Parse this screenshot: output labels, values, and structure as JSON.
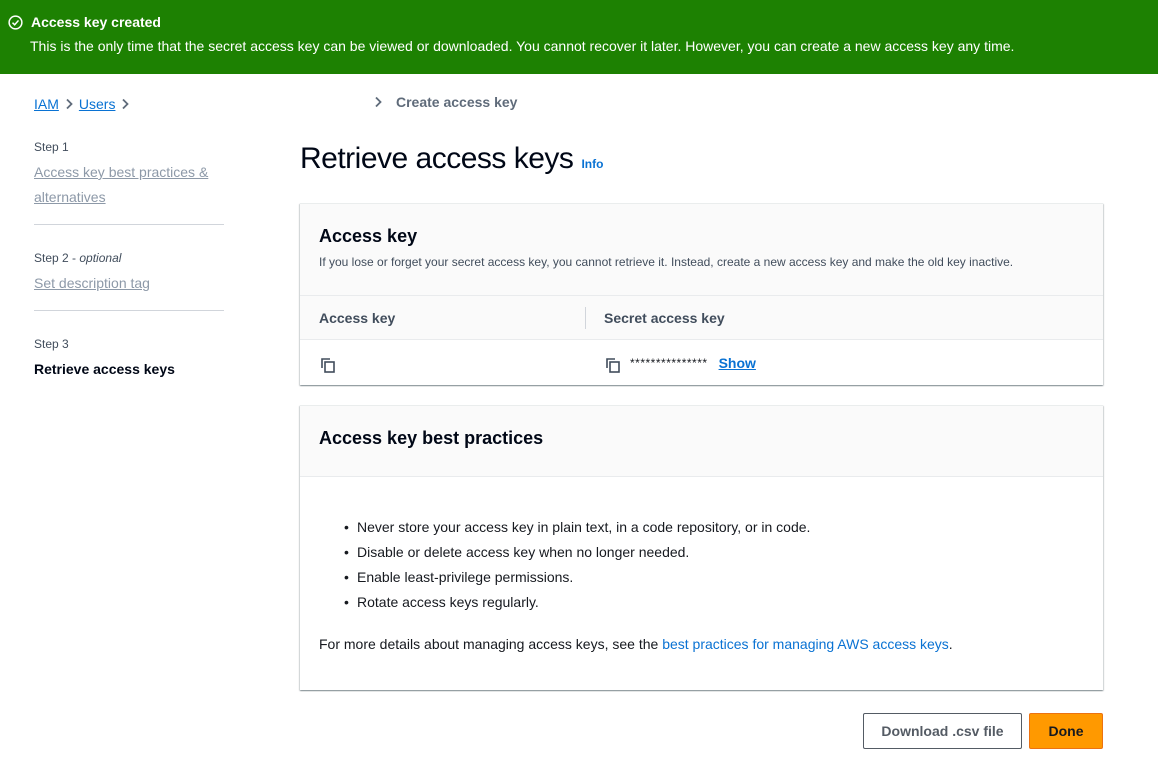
{
  "flash": {
    "title": "Access key created",
    "message": "This is the only time that the secret access key can be viewed or downloaded. You cannot recover it later. However, you can create a new access key any time.",
    "icon": "check-circle-icon",
    "color": "#1d8102"
  },
  "breadcrumb": {
    "items": [
      "IAM",
      "Users"
    ],
    "current": "Create access key"
  },
  "steps": [
    {
      "number": "Step 1",
      "label": "Access key best practices & alternatives"
    },
    {
      "number": "Step 2",
      "optional": "optional",
      "label": "Set description tag"
    },
    {
      "number": "Step 3",
      "label": "Retrieve access keys"
    }
  ],
  "page": {
    "title": "Retrieve access keys",
    "info": "Info"
  },
  "access_key_panel": {
    "title": "Access key",
    "description": "If you lose or forget your secret access key, you cannot retrieve it. Instead, create a new access key and make the old key inactive.",
    "col_access_key": "Access key",
    "col_secret_key": "Secret access key",
    "access_key_value": "",
    "secret_masked": "***************",
    "show_label": "Show"
  },
  "best_practices": {
    "title": "Access key best practices",
    "items": [
      "Never store your access key in plain text, in a code repository, or in code.",
      "Disable or delete access key when no longer needed.",
      "Enable least-privilege permissions.",
      "Rotate access keys regularly."
    ],
    "details_prefix": "For more details about managing access keys, see the ",
    "details_link": "best practices for managing AWS access keys",
    "details_suffix": "."
  },
  "actions": {
    "download": "Download .csv file",
    "done": "Done"
  },
  "colors": {
    "link": "#0972d3",
    "primary_button": "#ff9900"
  }
}
